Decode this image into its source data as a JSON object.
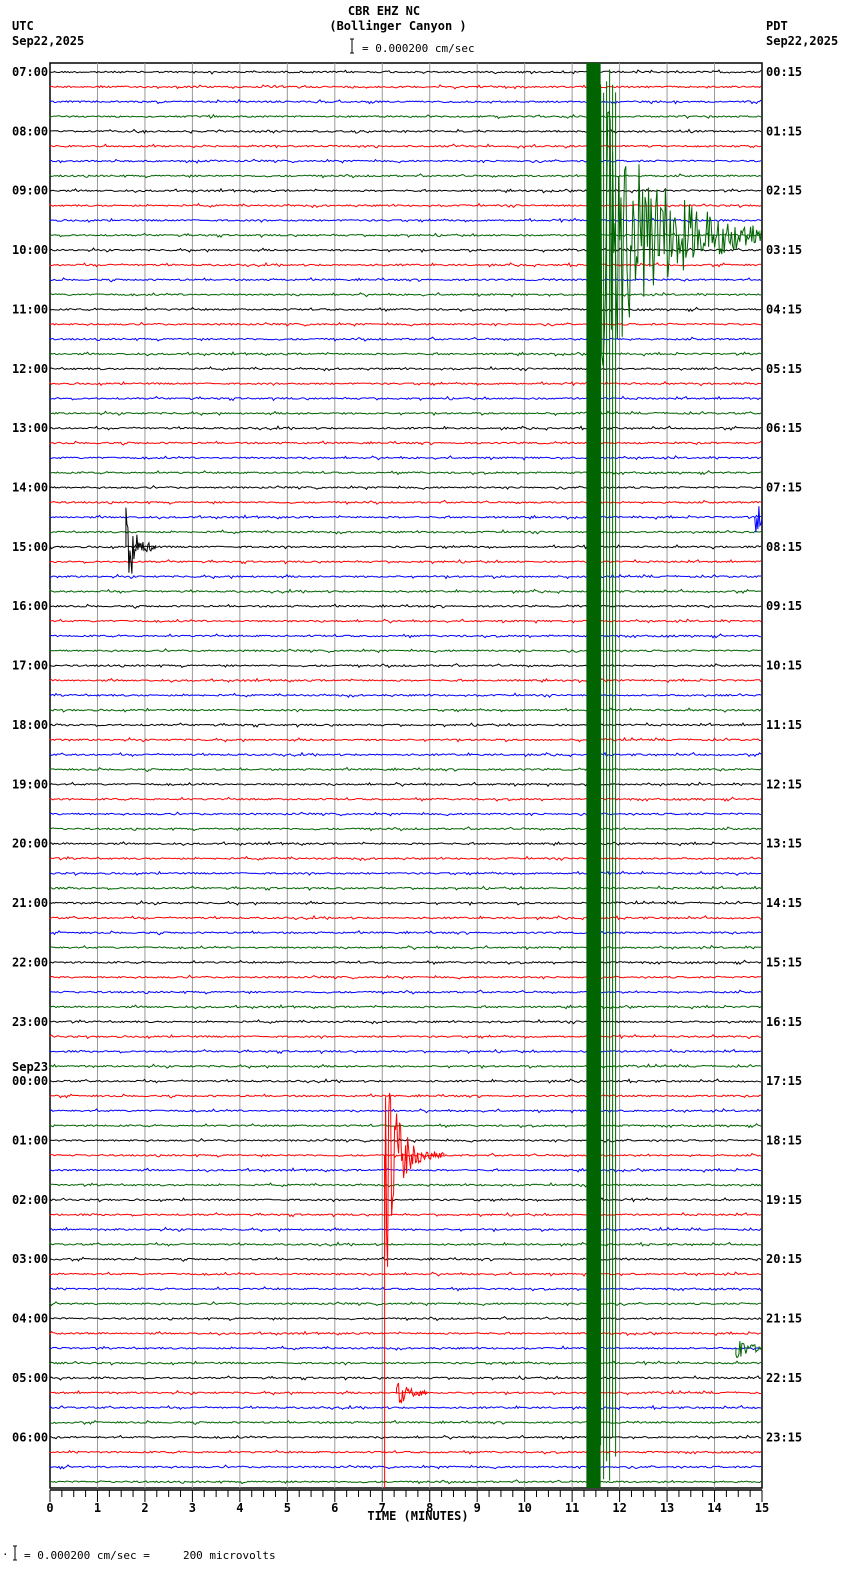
{
  "header": {
    "station": "CBR EHZ NC",
    "location": "(Bollinger Canyon )",
    "scale": "= 0.000200 cm/sec",
    "left_tz": "UTC",
    "left_date": "Sep22,2025",
    "right_tz": "PDT",
    "right_date": "Sep22,2025"
  },
  "footer": {
    "scale_note": "= 0.000200 cm/sec =     200 microvolts"
  },
  "chart_data": {
    "type": "line",
    "title": "CBR EHZ NC (Bollinger Canyon )",
    "xlabel": "TIME (MINUTES)",
    "xlim": [
      0,
      15
    ],
    "x_ticks": [
      "0",
      "1",
      "2",
      "3",
      "4",
      "5",
      "6",
      "7",
      "8",
      "9",
      "10",
      "11",
      "12",
      "13",
      "14",
      "15"
    ],
    "minutes_per_trace": 15,
    "trace_count": 96,
    "trace_colors": [
      "#000000",
      "#ff0000",
      "#0000ff",
      "#006400"
    ],
    "left_labels": [
      {
        "trace": 0,
        "text": "07:00"
      },
      {
        "trace": 4,
        "text": "08:00"
      },
      {
        "trace": 8,
        "text": "09:00"
      },
      {
        "trace": 12,
        "text": "10:00"
      },
      {
        "trace": 16,
        "text": "11:00"
      },
      {
        "trace": 20,
        "text": "12:00"
      },
      {
        "trace": 24,
        "text": "13:00"
      },
      {
        "trace": 28,
        "text": "14:00"
      },
      {
        "trace": 32,
        "text": "15:00"
      },
      {
        "trace": 36,
        "text": "16:00"
      },
      {
        "trace": 40,
        "text": "17:00"
      },
      {
        "trace": 44,
        "text": "18:00"
      },
      {
        "trace": 48,
        "text": "19:00"
      },
      {
        "trace": 52,
        "text": "20:00"
      },
      {
        "trace": 56,
        "text": "21:00"
      },
      {
        "trace": 60,
        "text": "22:00"
      },
      {
        "trace": 64,
        "text": "23:00"
      },
      {
        "trace": 68,
        "text": "00:00",
        "date": "Sep23"
      },
      {
        "trace": 72,
        "text": "01:00"
      },
      {
        "trace": 76,
        "text": "02:00"
      },
      {
        "trace": 80,
        "text": "03:00"
      },
      {
        "trace": 84,
        "text": "04:00"
      },
      {
        "trace": 88,
        "text": "05:00"
      },
      {
        "trace": 92,
        "text": "06:00"
      }
    ],
    "right_labels": [
      {
        "trace": 0,
        "text": "00:15"
      },
      {
        "trace": 4,
        "text": "01:15"
      },
      {
        "trace": 8,
        "text": "02:15"
      },
      {
        "trace": 12,
        "text": "03:15"
      },
      {
        "trace": 16,
        "text": "04:15"
      },
      {
        "trace": 20,
        "text": "05:15"
      },
      {
        "trace": 24,
        "text": "06:15"
      },
      {
        "trace": 28,
        "text": "07:15"
      },
      {
        "trace": 32,
        "text": "08:15"
      },
      {
        "trace": 36,
        "text": "09:15"
      },
      {
        "trace": 40,
        "text": "10:15"
      },
      {
        "trace": 44,
        "text": "11:15"
      },
      {
        "trace": 48,
        "text": "12:15"
      },
      {
        "trace": 52,
        "text": "13:15"
      },
      {
        "trace": 56,
        "text": "14:15"
      },
      {
        "trace": 60,
        "text": "15:15"
      },
      {
        "trace": 64,
        "text": "16:15"
      },
      {
        "trace": 68,
        "text": "17:15"
      },
      {
        "trace": 72,
        "text": "18:15"
      },
      {
        "trace": 76,
        "text": "19:15"
      },
      {
        "trace": 80,
        "text": "20:15"
      },
      {
        "trace": 84,
        "text": "21:15"
      },
      {
        "trace": 88,
        "text": "22:15"
      },
      {
        "trace": 92,
        "text": "23:15"
      }
    ],
    "events": [
      {
        "trace": 11,
        "minute": 11.3,
        "type": "large-saturated",
        "color": "#006400"
      },
      {
        "trace": 73,
        "minute": 7.05,
        "type": "large",
        "color": "#ff0000"
      },
      {
        "trace": 32,
        "minute": 1.6,
        "type": "medium",
        "color": "#000000"
      },
      {
        "trace": 30,
        "minute": 14.85,
        "type": "small",
        "color": "#0000ff"
      },
      {
        "trace": 89,
        "minute": 7.3,
        "type": "small",
        "color": "#ff0000"
      },
      {
        "trace": 86,
        "minute": 14.45,
        "type": "small",
        "color": "#006400"
      }
    ]
  }
}
